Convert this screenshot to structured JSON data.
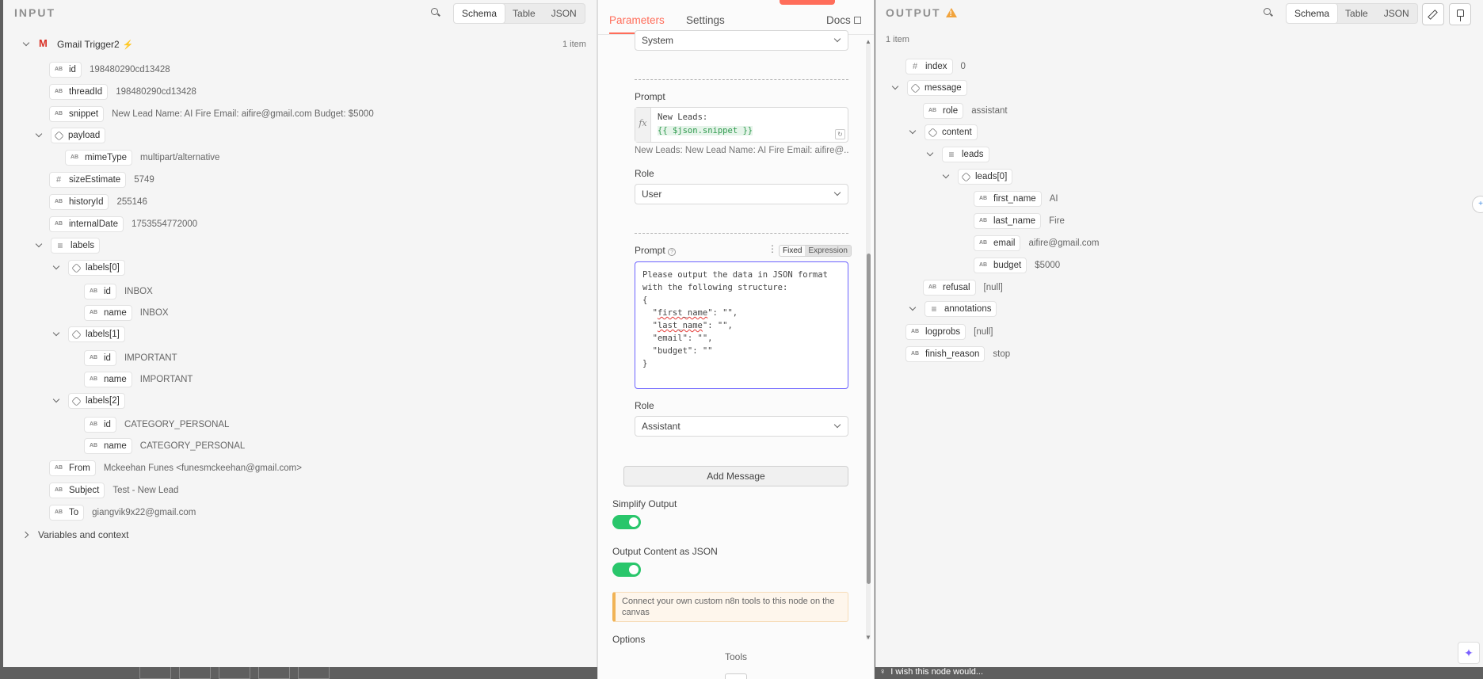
{
  "input": {
    "title": "INPUT",
    "views": [
      "Schema",
      "Table",
      "JSON"
    ],
    "active_view": "Schema",
    "item_count": "1 item",
    "root_label": "Gmail Trigger2",
    "rows": [
      {
        "key": "id",
        "value": "198480290cd13428"
      },
      {
        "key": "threadId",
        "value": "198480290cd13428"
      },
      {
        "key": "snippet",
        "value": "New Lead Name: AI Fire Email: aifire@gmail.com Budget: $5000"
      },
      {
        "key": "payload",
        "value": ""
      },
      {
        "key": "mimeType",
        "value": "multipart/alternative"
      },
      {
        "key": "sizeEstimate",
        "value": "5749"
      },
      {
        "key": "historyId",
        "value": "255146"
      },
      {
        "key": "internalDate",
        "value": "1753554772000"
      },
      {
        "key": "labels",
        "value": ""
      },
      {
        "key": "labels[0]",
        "value": ""
      },
      {
        "key": "id",
        "value": "INBOX"
      },
      {
        "key": "name",
        "value": "INBOX"
      },
      {
        "key": "labels[1]",
        "value": ""
      },
      {
        "key": "id",
        "value": "IMPORTANT"
      },
      {
        "key": "name",
        "value": "IMPORTANT"
      },
      {
        "key": "labels[2]",
        "value": ""
      },
      {
        "key": "id",
        "value": "CATEGORY_PERSONAL"
      },
      {
        "key": "name",
        "value": "CATEGORY_PERSONAL"
      },
      {
        "key": "From",
        "value": "Mckeehan Funes <funesmckeehan@gmail.com>"
      },
      {
        "key": "Subject",
        "value": "Test - New Lead"
      },
      {
        "key": "To",
        "value": "giangvik9x22@gmail.com"
      }
    ],
    "variables_label": "Variables and context"
  },
  "params": {
    "tabs": [
      "Parameters",
      "Settings"
    ],
    "docs_label": "Docs",
    "role_top": "System",
    "prompt1_label": "Prompt",
    "prompt1_line1": "New Leads:",
    "prompt1_line2": "{{ $json.snippet }}",
    "prompt1_preview": "New Leads: New Lead Name: AI Fire Email: aifire@...",
    "role1_label": "Role",
    "role1_value": "User",
    "prompt2_label": "Prompt",
    "fixed_label": "Fixed",
    "expression_label": "Expression",
    "prompt2_text": {
      "l1": "Please output the data in JSON format",
      "l2": "with the following structure:",
      "l3": "{",
      "l4a": "  \"",
      "l4b": "first_name",
      "l4c": "\": \"\",",
      "l5a": "  \"",
      "l5b": "last_name",
      "l5c": "\": \"\",",
      "l6": "  \"email\": \"\",",
      "l7": "  \"budget\": \"\"",
      "l8": "}"
    },
    "role2_label": "Role",
    "role2_value": "Assistant",
    "add_message": "Add Message",
    "simplify_label": "Simplify Output",
    "simplify_on": true,
    "json_label": "Output Content as JSON",
    "json_on": true,
    "notice": "Connect your own custom n8n tools to this node on the canvas",
    "options_label": "Options",
    "tools_label": "Tools",
    "accent": "#ff6d5a"
  },
  "output": {
    "title": "OUTPUT",
    "views": [
      "Schema",
      "Table",
      "JSON"
    ],
    "active_view": "Schema",
    "item_count": "1 item",
    "rows": [
      {
        "key": "index",
        "value": "0"
      },
      {
        "key": "message",
        "value": ""
      },
      {
        "key": "role",
        "value": "assistant"
      },
      {
        "key": "content",
        "value": ""
      },
      {
        "key": "leads",
        "value": ""
      },
      {
        "key": "leads[0]",
        "value": ""
      },
      {
        "key": "first_name",
        "value": "AI"
      },
      {
        "key": "last_name",
        "value": "Fire"
      },
      {
        "key": "email",
        "value": "aifire@gmail.com"
      },
      {
        "key": "budget",
        "value": "$5000"
      },
      {
        "key": "refusal",
        "value": "[null]"
      },
      {
        "key": "annotations",
        "value": ""
      },
      {
        "key": "logprobs",
        "value": "[null]"
      },
      {
        "key": "finish_reason",
        "value": "stop"
      }
    ],
    "feedback": "I wish this node would..."
  }
}
